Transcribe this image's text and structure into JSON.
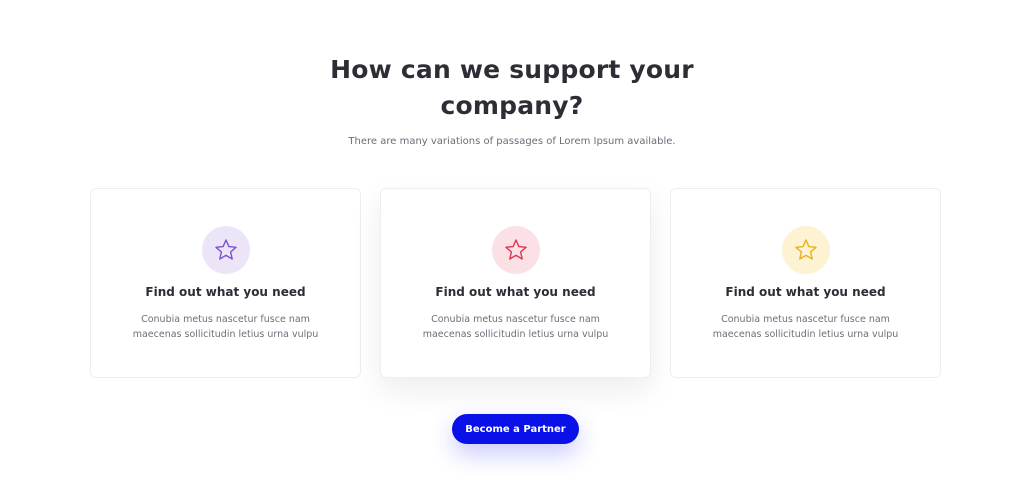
{
  "section": {
    "heading_line1": "How can we support your",
    "heading_line2": "company?",
    "subtitle": "There are many variations of passages of Lorem Ipsum available."
  },
  "cards": [
    {
      "title": "Find out what you need",
      "text_line1": "Conubia metus nascetur fusce nam",
      "text_line2": "maecenas sollicitudin letius urna vulpu",
      "icon": "star-icon",
      "icon_color": "#7b4fd6",
      "icon_bg": "#ece5f8"
    },
    {
      "title": "Find out what you need",
      "text_line1": "Conubia metus nascetur fusce nam",
      "text_line2": "maecenas sollicitudin letius urna vulpu",
      "icon": "star-icon",
      "icon_color": "#e0344f",
      "icon_bg": "#fbe1e5"
    },
    {
      "title": "Find out what you need",
      "text_line1": "Conubia metus nascetur fusce nam",
      "text_line2": "maecenas sollicitudin letius urna vulpu",
      "icon": "star-icon",
      "icon_color": "#e8b21c",
      "icon_bg": "#fdf2d2"
    }
  ],
  "cta": {
    "label": "Become a Partner",
    "color": "#0a10e8"
  }
}
